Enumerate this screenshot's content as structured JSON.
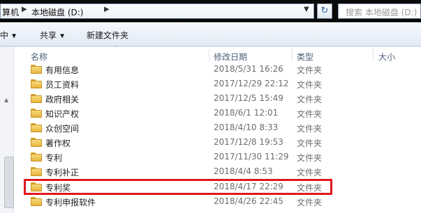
{
  "address": {
    "crumbs": [
      "算机",
      "本地磁盘 (D:)"
    ],
    "search_placeholder": "搜索 本地磁盘 (D:)"
  },
  "toolbar": {
    "include_label": "中",
    "share_label": "共享",
    "new_folder_label": "新建文件夹"
  },
  "columns": {
    "name": "名称",
    "date": "修改日期",
    "type": "类型",
    "size": "大小"
  },
  "files": [
    {
      "name": "有用信息",
      "date": "2018/5/31 16:26",
      "type": "文件夹"
    },
    {
      "name": "员工资料",
      "date": "2017/12/29 22:12",
      "type": "文件夹"
    },
    {
      "name": "政府相关",
      "date": "2017/12/5 15:49",
      "type": "文件夹"
    },
    {
      "name": "知识产权",
      "date": "2018/6/1 12:01",
      "type": "文件夹"
    },
    {
      "name": "众创空间",
      "date": "2018/4/10 8:33",
      "type": "文件夹"
    },
    {
      "name": "著作权",
      "date": "2017/12/8 19:53",
      "type": "文件夹"
    },
    {
      "name": "专利",
      "date": "2017/11/30 11:29",
      "type": "文件夹"
    },
    {
      "name": "专利补正",
      "date": "2018/4/4 8:53",
      "type": "文件夹"
    },
    {
      "name": "专利奖",
      "date": "2018/4/17 22:29",
      "type": "文件夹",
      "highlighted": true
    },
    {
      "name": "专利申报软件",
      "date": "2018/4/26 22:45",
      "type": "文件夹"
    }
  ],
  "colors": {
    "highlight_border": "#e0181e",
    "folder": "#e8b43b",
    "header_text": "#4c607a"
  }
}
